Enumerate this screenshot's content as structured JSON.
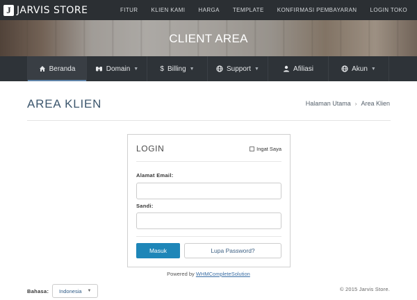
{
  "brand": {
    "logo_glyph": "J",
    "name": "JARVIS STORE"
  },
  "top_nav": [
    "FITUR",
    "KLIEN KAMI",
    "HARGA",
    "TEMPLATE",
    "KONFIRMASI PEMBAYARAN",
    "LOGIN TOKO"
  ],
  "hero": {
    "title": "CLIENT AREA"
  },
  "main_nav": [
    {
      "label": "Beranda",
      "icon": "home-icon",
      "caret": false,
      "active": true
    },
    {
      "label": "Domain",
      "icon": "binoculars-icon",
      "caret": true,
      "active": false
    },
    {
      "label": "Billing",
      "icon": "dollar-icon",
      "caret": true,
      "active": false
    },
    {
      "label": "Support",
      "icon": "globe-icon",
      "caret": true,
      "active": false
    },
    {
      "label": "Afiliasi",
      "icon": "user-icon",
      "caret": false,
      "active": false
    },
    {
      "label": "Akun",
      "icon": "globe-icon",
      "caret": true,
      "active": false
    }
  ],
  "page": {
    "title": "AREA KLIEN",
    "breadcrumb": {
      "home": "Halaman Utama",
      "current": "Area Klien"
    }
  },
  "login": {
    "title": "LOGIN",
    "remember_label": "Ingat Saya",
    "remember_checked": false,
    "email_label": "Alamat Email:",
    "email_value": "",
    "password_label": "Sandi:",
    "password_value": "",
    "submit_label": "Masuk",
    "forgot_label": "Lupa Password?"
  },
  "powered": {
    "prefix": "Powered by ",
    "link": "WHMCompleteSolution"
  },
  "footer": {
    "language_label": "Bahasa:",
    "language_value": "Indonesia",
    "copyright": "© 2015 Jarvis Store."
  },
  "colors": {
    "topbar": "#2b2f33",
    "mainnav": "#2e3338",
    "accent_button": "#1e86b8",
    "title_text": "#3c566d",
    "link": "#3a6ea5"
  }
}
